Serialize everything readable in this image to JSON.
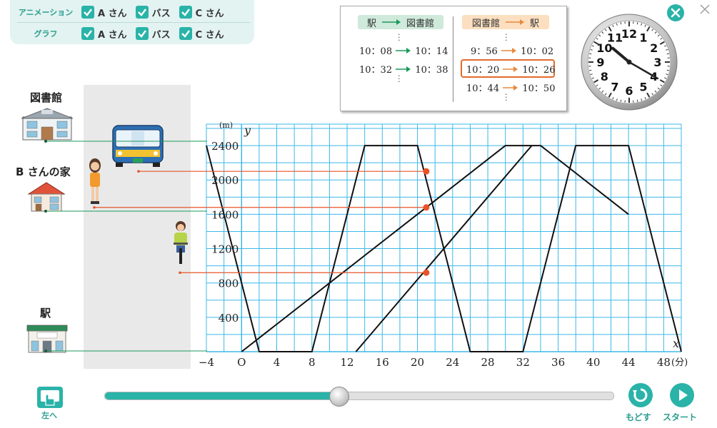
{
  "controls": {
    "rows": [
      {
        "label": "アニメーション",
        "items": [
          {
            "label": "A さん",
            "checked": true
          },
          {
            "label": "バス",
            "checked": true
          },
          {
            "label": "C さん",
            "checked": true
          }
        ]
      },
      {
        "label": "グラフ",
        "items": [
          {
            "label": "A さん",
            "checked": true
          },
          {
            "label": "バス",
            "checked": true
          },
          {
            "label": "C さん",
            "checked": true
          }
        ]
      }
    ]
  },
  "timetable": {
    "left_header": {
      "from": "駅",
      "to": "図書館"
    },
    "right_header": {
      "from": "図書館",
      "to": "駅"
    },
    "left_rows": [
      {
        "depart": "10：08",
        "arrive": "10：14"
      },
      {
        "depart": "10：32",
        "arrive": "10：38"
      }
    ],
    "right_rows": [
      {
        "depart": "9：56",
        "arrive": "10：02"
      },
      {
        "depart": "10：20",
        "arrive": "10：26"
      },
      {
        "depart": "10：44",
        "arrive": "10：50"
      }
    ],
    "highlighted_right_row": 1,
    "colors": {
      "left": "#1a9a5a",
      "right": "#e88a3a",
      "highlight": "#e26a2c"
    }
  },
  "clock": {
    "hour": 10,
    "minute": 20,
    "numbers": [
      "12",
      "1",
      "2",
      "3",
      "4",
      "5",
      "6",
      "7",
      "8",
      "9",
      "10",
      "11"
    ]
  },
  "places": {
    "library": "図書館",
    "home_b": "B さんの家",
    "station": "駅"
  },
  "chart_data": {
    "type": "line",
    "xlabel": "x",
    "ylabel": "y",
    "x_unit": "(分)",
    "y_unit": "(m)",
    "xlim": [
      -4,
      50
    ],
    "ylim": [
      0,
      2650
    ],
    "x_grid_step": 2,
    "y_grid_step": 200,
    "x_tick_values": [
      -4,
      0,
      4,
      8,
      12,
      16,
      20,
      24,
      28,
      32,
      36,
      40,
      44,
      48
    ],
    "x_tick_labels": [
      "−4",
      "O",
      "4",
      "8",
      "12",
      "16",
      "20",
      "24",
      "28",
      "32",
      "36",
      "40",
      "44",
      "48"
    ],
    "y_tick_values": [
      400,
      800,
      1200,
      1600,
      2000,
      2400
    ],
    "y_tick_labels": [
      "400",
      "800",
      "1200",
      "1600",
      "2000",
      "2400"
    ],
    "grid": true,
    "series": [
      {
        "points": [
          [
            -4,
            2400
          ],
          [
            2,
            0
          ],
          [
            8,
            0
          ],
          [
            14,
            2400
          ],
          [
            20,
            2400
          ],
          [
            26,
            0
          ],
          [
            32,
            0
          ],
          [
            38,
            2400
          ],
          [
            44,
            2400
          ],
          [
            50,
            0
          ]
        ]
      },
      {
        "points": [
          [
            0,
            0
          ],
          [
            30,
            2400
          ],
          [
            34,
            2400
          ],
          [
            44,
            1600
          ]
        ]
      },
      {
        "points": [
          [
            13,
            0
          ],
          [
            33,
            2400
          ]
        ]
      }
    ],
    "current_x": 21,
    "markers": [
      {
        "x": 21,
        "y": 2100
      },
      {
        "x": 21,
        "y": 1680
      },
      {
        "x": 21,
        "y": 920
      }
    ],
    "colors": {
      "grid": "#3db8e8",
      "line": "#111111",
      "marker": "#e8542a",
      "guide": "#1a9a5a"
    }
  },
  "slider": {
    "value": 0.46
  },
  "buttons": {
    "left": "左へ",
    "reset": "もどす",
    "start": "スタート"
  }
}
